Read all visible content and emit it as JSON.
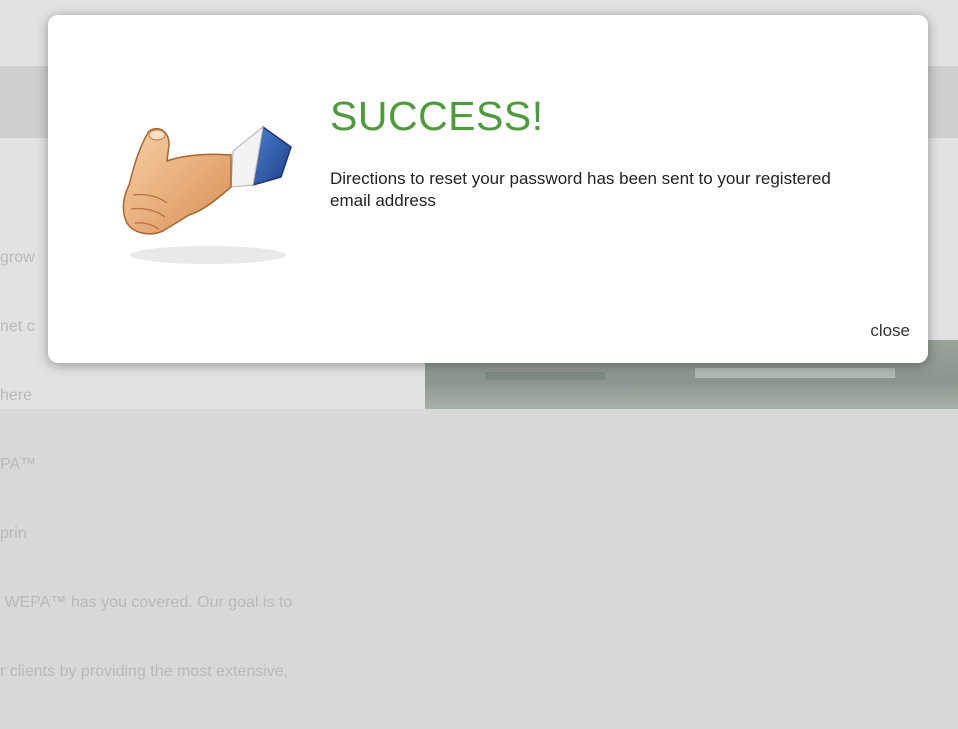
{
  "background": {
    "text_lines": [
      "grow",
      "net c",
      "here",
      "PA™",
      "prin",
      " WEPA™ has you covered. Our goal is to",
      "r clients by providing the most extensive,"
    ]
  },
  "modal": {
    "title": "SUCCESS!",
    "message": "Directions to reset your password has been sent to your registered email address",
    "close_label": "close",
    "icon": "thumbs-up-icon",
    "colors": {
      "title": "#4f9a3c",
      "text": "#222222",
      "sleeve": "#2f5fae"
    }
  }
}
